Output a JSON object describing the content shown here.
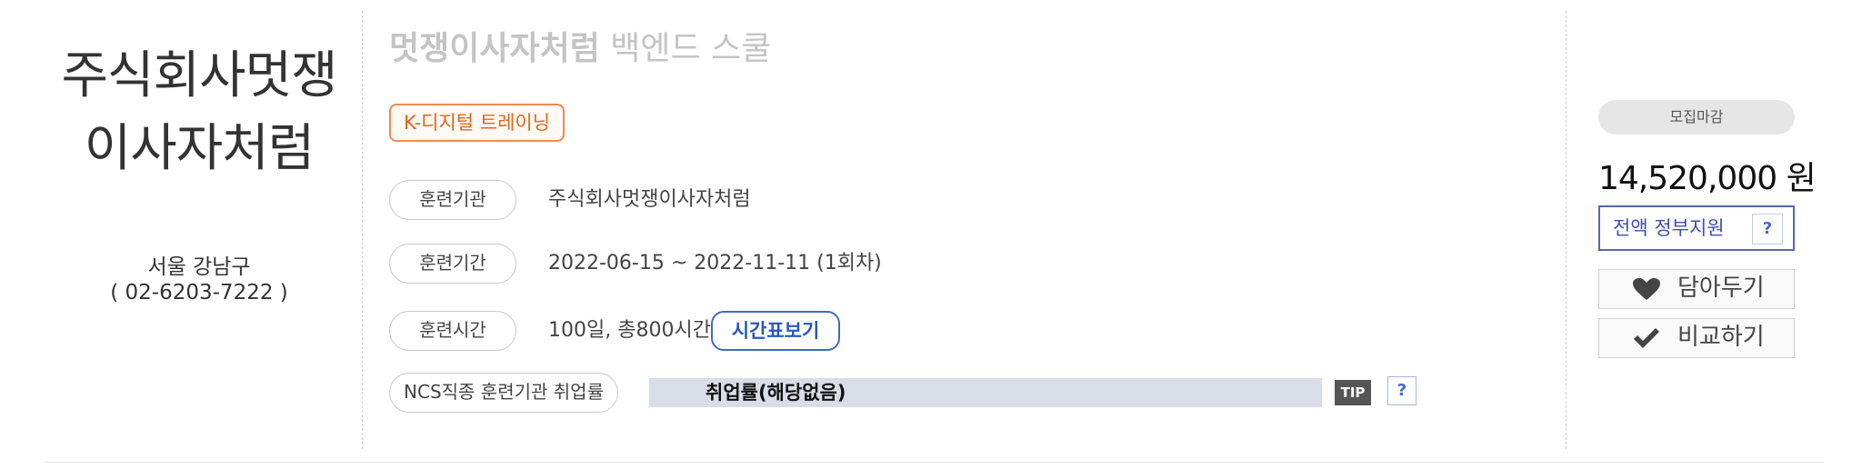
{
  "institution": {
    "name": "주식회사멋쟁이사자처럼",
    "address": "서울 강남구",
    "phone": "( 02-6203-7222 )"
  },
  "course": {
    "title_bold": "멋쟁이사자처럼",
    "title_rest": " 백엔드 스쿨",
    "tag": "K-디지털 트레이닝"
  },
  "details": [
    {
      "label": "훈련기관",
      "value": "주식회사멋쟁이사자처럼"
    },
    {
      "label": "훈련기간",
      "value": "2022-06-15 ~ 2022-11-11 (1회차)"
    },
    {
      "label": "훈련시간",
      "value": "100일, 총800시간"
    }
  ],
  "timetable_button": "시간표보기",
  "employment": {
    "label": "NCS직종 훈련기관 취업률",
    "rate_text": "취업률(해당없음)",
    "tip": "TIP",
    "help": "?"
  },
  "sidebar": {
    "status": "모집마감",
    "price": "14,520,000 원",
    "support": "전액 정부지원",
    "support_help": "?",
    "wishlist": "담아두기",
    "compare": "비교하기"
  },
  "colors": {
    "tag_orange": "#e0661a",
    "link_blue": "#2b59b8",
    "support_border": "#5866b7",
    "rate_bar": "#d8dde8"
  },
  "icons": {
    "wishlist": "heart-icon",
    "compare": "check-icon"
  }
}
